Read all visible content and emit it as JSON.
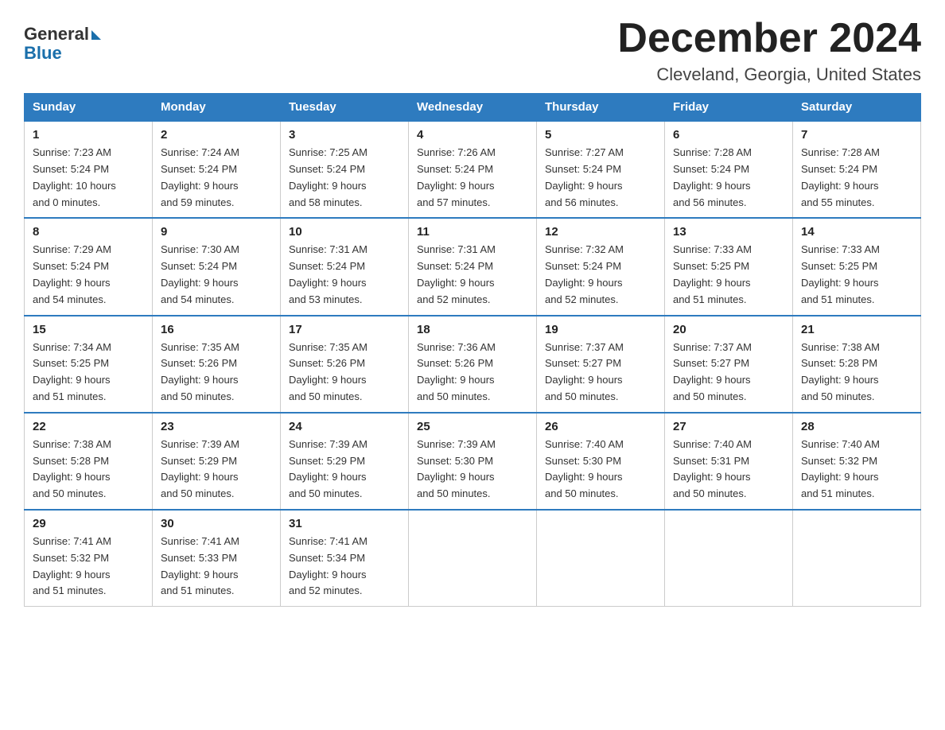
{
  "logo": {
    "general": "General",
    "blue": "Blue"
  },
  "title": "December 2024",
  "location": "Cleveland, Georgia, United States",
  "days_of_week": [
    "Sunday",
    "Monday",
    "Tuesday",
    "Wednesday",
    "Thursday",
    "Friday",
    "Saturday"
  ],
  "weeks": [
    [
      {
        "day": "1",
        "sunrise": "7:23 AM",
        "sunset": "5:24 PM",
        "daylight": "10 hours and 0 minutes."
      },
      {
        "day": "2",
        "sunrise": "7:24 AM",
        "sunset": "5:24 PM",
        "daylight": "9 hours and 59 minutes."
      },
      {
        "day": "3",
        "sunrise": "7:25 AM",
        "sunset": "5:24 PM",
        "daylight": "9 hours and 58 minutes."
      },
      {
        "day": "4",
        "sunrise": "7:26 AM",
        "sunset": "5:24 PM",
        "daylight": "9 hours and 57 minutes."
      },
      {
        "day": "5",
        "sunrise": "7:27 AM",
        "sunset": "5:24 PM",
        "daylight": "9 hours and 56 minutes."
      },
      {
        "day": "6",
        "sunrise": "7:28 AM",
        "sunset": "5:24 PM",
        "daylight": "9 hours and 56 minutes."
      },
      {
        "day": "7",
        "sunrise": "7:28 AM",
        "sunset": "5:24 PM",
        "daylight": "9 hours and 55 minutes."
      }
    ],
    [
      {
        "day": "8",
        "sunrise": "7:29 AM",
        "sunset": "5:24 PM",
        "daylight": "9 hours and 54 minutes."
      },
      {
        "day": "9",
        "sunrise": "7:30 AM",
        "sunset": "5:24 PM",
        "daylight": "9 hours and 54 minutes."
      },
      {
        "day": "10",
        "sunrise": "7:31 AM",
        "sunset": "5:24 PM",
        "daylight": "9 hours and 53 minutes."
      },
      {
        "day": "11",
        "sunrise": "7:31 AM",
        "sunset": "5:24 PM",
        "daylight": "9 hours and 52 minutes."
      },
      {
        "day": "12",
        "sunrise": "7:32 AM",
        "sunset": "5:24 PM",
        "daylight": "9 hours and 52 minutes."
      },
      {
        "day": "13",
        "sunrise": "7:33 AM",
        "sunset": "5:25 PM",
        "daylight": "9 hours and 51 minutes."
      },
      {
        "day": "14",
        "sunrise": "7:33 AM",
        "sunset": "5:25 PM",
        "daylight": "9 hours and 51 minutes."
      }
    ],
    [
      {
        "day": "15",
        "sunrise": "7:34 AM",
        "sunset": "5:25 PM",
        "daylight": "9 hours and 51 minutes."
      },
      {
        "day": "16",
        "sunrise": "7:35 AM",
        "sunset": "5:26 PM",
        "daylight": "9 hours and 50 minutes."
      },
      {
        "day": "17",
        "sunrise": "7:35 AM",
        "sunset": "5:26 PM",
        "daylight": "9 hours and 50 minutes."
      },
      {
        "day": "18",
        "sunrise": "7:36 AM",
        "sunset": "5:26 PM",
        "daylight": "9 hours and 50 minutes."
      },
      {
        "day": "19",
        "sunrise": "7:37 AM",
        "sunset": "5:27 PM",
        "daylight": "9 hours and 50 minutes."
      },
      {
        "day": "20",
        "sunrise": "7:37 AM",
        "sunset": "5:27 PM",
        "daylight": "9 hours and 50 minutes."
      },
      {
        "day": "21",
        "sunrise": "7:38 AM",
        "sunset": "5:28 PM",
        "daylight": "9 hours and 50 minutes."
      }
    ],
    [
      {
        "day": "22",
        "sunrise": "7:38 AM",
        "sunset": "5:28 PM",
        "daylight": "9 hours and 50 minutes."
      },
      {
        "day": "23",
        "sunrise": "7:39 AM",
        "sunset": "5:29 PM",
        "daylight": "9 hours and 50 minutes."
      },
      {
        "day": "24",
        "sunrise": "7:39 AM",
        "sunset": "5:29 PM",
        "daylight": "9 hours and 50 minutes."
      },
      {
        "day": "25",
        "sunrise": "7:39 AM",
        "sunset": "5:30 PM",
        "daylight": "9 hours and 50 minutes."
      },
      {
        "day": "26",
        "sunrise": "7:40 AM",
        "sunset": "5:30 PM",
        "daylight": "9 hours and 50 minutes."
      },
      {
        "day": "27",
        "sunrise": "7:40 AM",
        "sunset": "5:31 PM",
        "daylight": "9 hours and 50 minutes."
      },
      {
        "day": "28",
        "sunrise": "7:40 AM",
        "sunset": "5:32 PM",
        "daylight": "9 hours and 51 minutes."
      }
    ],
    [
      {
        "day": "29",
        "sunrise": "7:41 AM",
        "sunset": "5:32 PM",
        "daylight": "9 hours and 51 minutes."
      },
      {
        "day": "30",
        "sunrise": "7:41 AM",
        "sunset": "5:33 PM",
        "daylight": "9 hours and 51 minutes."
      },
      {
        "day": "31",
        "sunrise": "7:41 AM",
        "sunset": "5:34 PM",
        "daylight": "9 hours and 52 minutes."
      },
      null,
      null,
      null,
      null
    ]
  ],
  "labels": {
    "sunrise": "Sunrise:",
    "sunset": "Sunset:",
    "daylight": "Daylight:"
  }
}
